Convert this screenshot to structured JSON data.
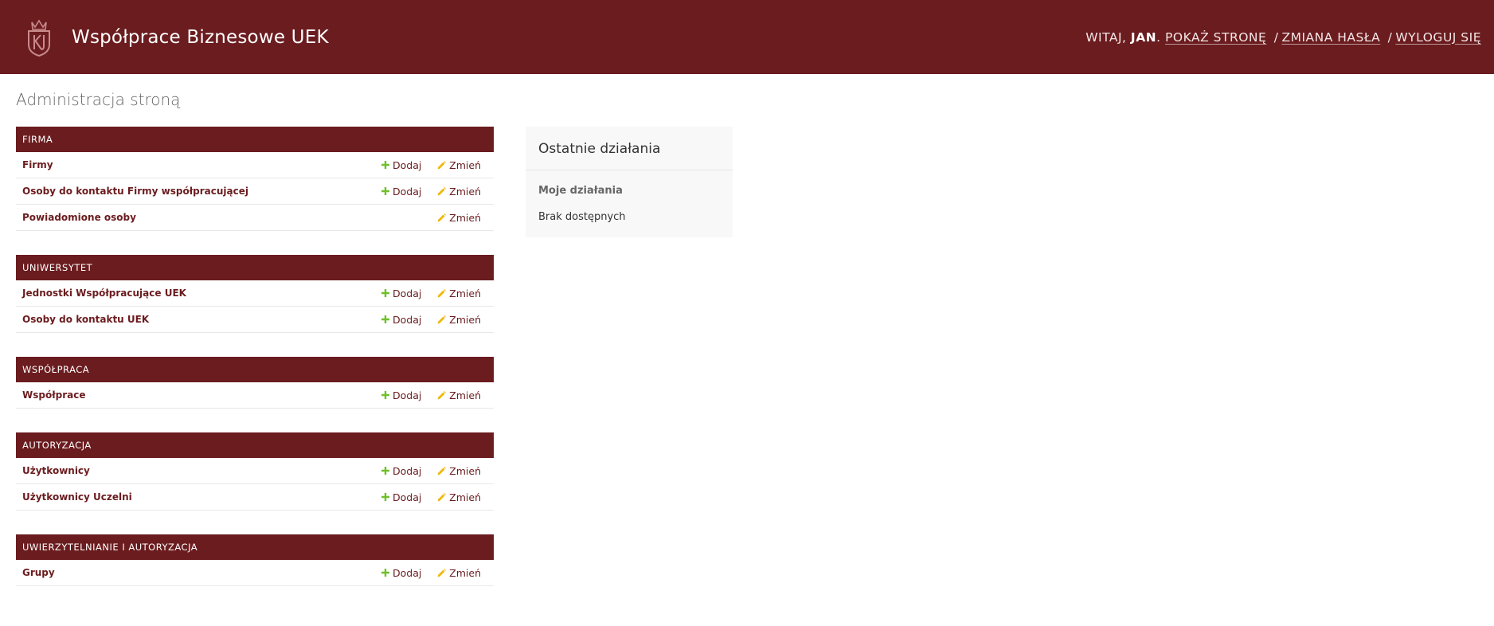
{
  "header": {
    "site_title": "Współprace Biznesowe UEK",
    "welcome": "Witaj,",
    "username": "Jan",
    "view_site": "Pokaż stronę",
    "change_password": "Zmiana hasła",
    "logout": "Wyloguj się",
    "separator": "/"
  },
  "page_title": "Administracja stroną",
  "modules": [
    {
      "caption": "Firma",
      "models": [
        {
          "name": "Firmy",
          "add": "Dodaj",
          "change": "Zmień"
        },
        {
          "name": "Osoby do kontaktu Firmy współpracującej",
          "add": "Dodaj",
          "change": "Zmień"
        },
        {
          "name": "Powiadomione osoby",
          "change": "Zmień"
        }
      ]
    },
    {
      "caption": "Uniwersytet",
      "models": [
        {
          "name": "Jednostki Współpracujące UEK",
          "add": "Dodaj",
          "change": "Zmień"
        },
        {
          "name": "Osoby do kontaktu UEK",
          "add": "Dodaj",
          "change": "Zmień"
        }
      ]
    },
    {
      "caption": "Współpraca",
      "models": [
        {
          "name": "Współprace",
          "add": "Dodaj",
          "change": "Zmień"
        }
      ]
    },
    {
      "caption": "Autoryzacja",
      "models": [
        {
          "name": "Użytkownicy",
          "add": "Dodaj",
          "change": "Zmień"
        },
        {
          "name": "Użytkownicy Uczelni",
          "add": "Dodaj",
          "change": "Zmień"
        }
      ]
    },
    {
      "caption": "Uwierzytelnianie i autoryzacja",
      "models": [
        {
          "name": "Grupy",
          "add": "Dodaj",
          "change": "Zmień"
        }
      ]
    }
  ],
  "recent_actions": {
    "title": "Ostatnie działania",
    "my_actions": "Moje działania",
    "empty": "Brak dostępnych"
  },
  "icons": {
    "logo": "uek-crest-icon",
    "add": "plus-icon",
    "change": "pencil-icon"
  },
  "colors": {
    "brand": "#6b1c1f",
    "add_icon": "#70bf2b",
    "change_icon": "#efb80b"
  }
}
